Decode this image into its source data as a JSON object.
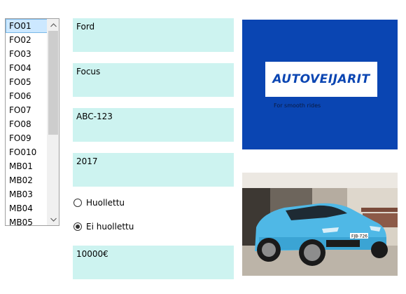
{
  "listbox": {
    "items": [
      "FO01",
      "FO02",
      "FO03",
      "FO04",
      "FO05",
      "FO06",
      "FO07",
      "FO08",
      "FO09",
      "FO010",
      "MB01",
      "MB02",
      "MB03",
      "MB04",
      "MB05"
    ],
    "selected_index": 0,
    "scroll_position": 0.0
  },
  "fields": {
    "make": "Ford",
    "model": "Focus",
    "plate": "ABC-123",
    "year": "2017",
    "price": "10000€"
  },
  "service_status": {
    "options": [
      {
        "label": "Huollettu",
        "checked": false
      },
      {
        "label": "Ei huollettu",
        "checked": true
      }
    ]
  },
  "logo": {
    "name": "AUTOVEIJARIT",
    "tagline": "For smooth rides",
    "background_color": "#0a45b2"
  },
  "car_photo": {
    "plate_text": "FJB-726",
    "car_color": "#4fb8e6"
  }
}
